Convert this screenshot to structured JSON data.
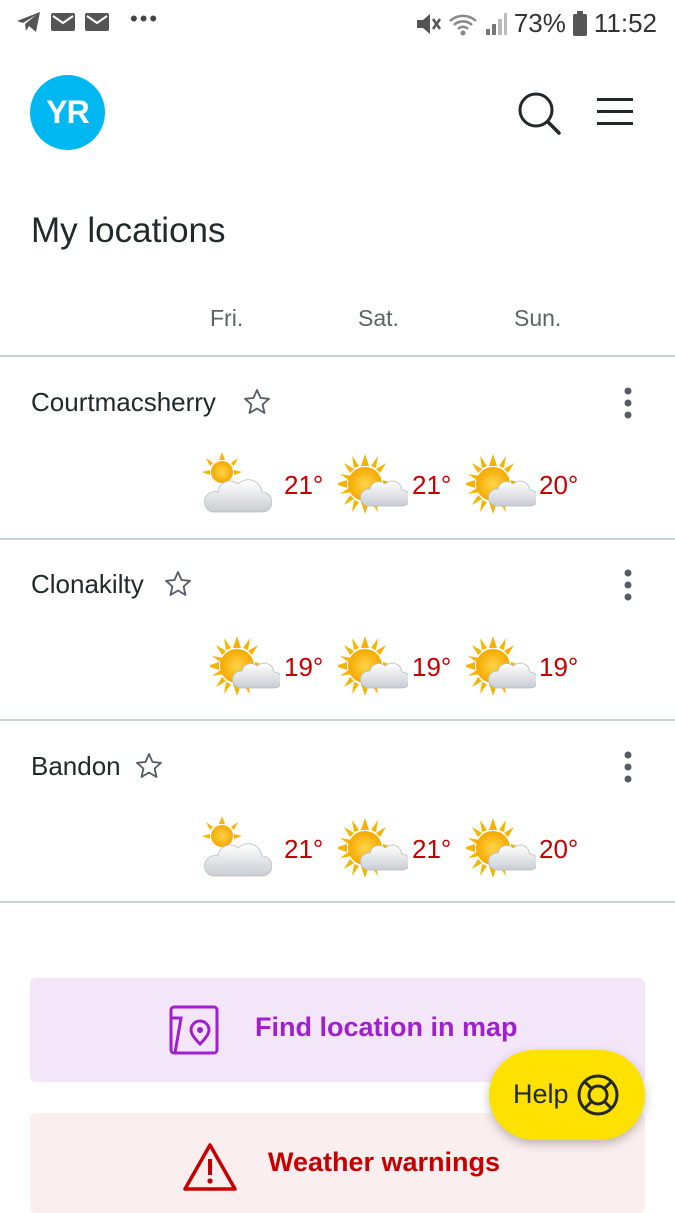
{
  "status_bar": {
    "battery": "73%",
    "time": "11:52",
    "left_icons": [
      "telegram-icon",
      "mail-icon",
      "mail-icon"
    ],
    "right_icons": [
      "mute-icon",
      "wifi-icon",
      "signal-icon",
      "battery-icon"
    ]
  },
  "header": {
    "logo_text": "YR",
    "logo_color": "#00b8f1"
  },
  "page": {
    "title": "My locations"
  },
  "days": [
    "Fri.",
    "Sat.",
    "Sun."
  ],
  "locations": [
    {
      "name": "Courtmacsherry",
      "forecast": [
        {
          "icon": "partly-cloudy-icon",
          "temp": "21°"
        },
        {
          "icon": "fair-icon",
          "temp": "21°"
        },
        {
          "icon": "fair-icon",
          "temp": "20°"
        }
      ]
    },
    {
      "name": "Clonakilty",
      "forecast": [
        {
          "icon": "fair-icon",
          "temp": "19°"
        },
        {
          "icon": "fair-icon",
          "temp": "19°"
        },
        {
          "icon": "fair-icon",
          "temp": "19°"
        }
      ]
    },
    {
      "name": "Bandon",
      "forecast": [
        {
          "icon": "partly-cloudy-icon",
          "temp": "21°"
        },
        {
          "icon": "fair-icon",
          "temp": "21°"
        },
        {
          "icon": "fair-icon",
          "temp": "20°"
        }
      ]
    }
  ],
  "actions": {
    "find_location": "Find location in map",
    "weather_warnings": "Weather warnings",
    "help": "Help"
  },
  "colors": {
    "temperature": "#c60000",
    "map_accent": "#a020d0",
    "help_bg": "#ffe100"
  }
}
